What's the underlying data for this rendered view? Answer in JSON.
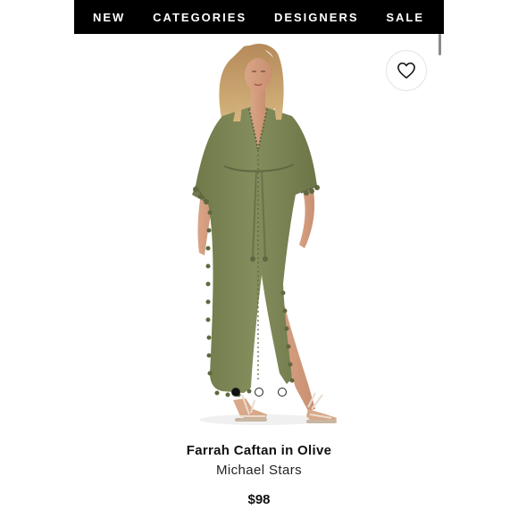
{
  "nav": {
    "items": [
      "NEW",
      "CATEGORIES",
      "DESIGNERS",
      "SALE"
    ]
  },
  "icons": {
    "wishlist": "heart-outline-icon"
  },
  "carousel": {
    "total": 3,
    "active": 1
  },
  "product": {
    "title": "Farrah Caftan in Olive",
    "designer": "Michael Stars",
    "price": "$98",
    "color_hex": "#7b8454"
  },
  "colors": {
    "nav_bg": "#000000",
    "nav_text": "#ffffff"
  }
}
